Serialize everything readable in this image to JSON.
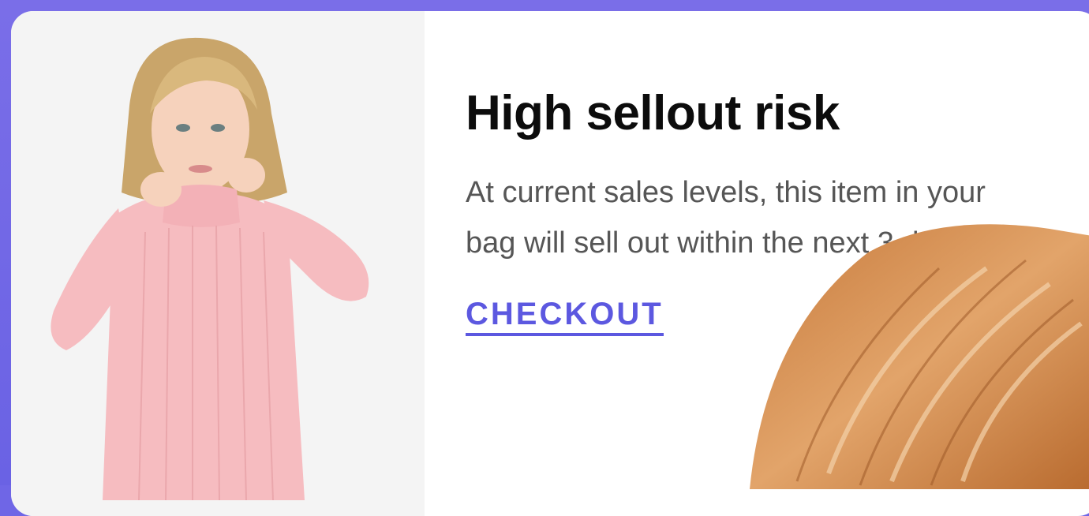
{
  "alert": {
    "title": "High sellout risk",
    "message": "At current sales levels, this item in your bag will sell out within the next 3 days.",
    "action_label": "CHECKOUT"
  },
  "product_image": {
    "subject": "model wearing pink ribbed turtleneck sweater"
  },
  "colors": {
    "frame": "#6f66e6",
    "card": "#ffffff",
    "photo_background": "#f4f4f4",
    "title": "#0c0c0c",
    "message": "#565656",
    "action": "#5c58e0",
    "sweater": "#f6bcc0",
    "hair_overlay": "#d48a4e"
  }
}
